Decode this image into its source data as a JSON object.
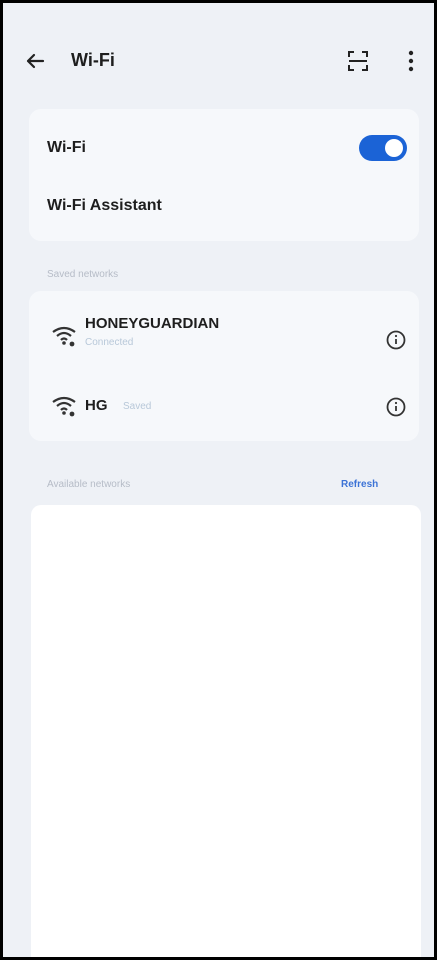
{
  "status_bar": {
    "left": "",
    "right": ""
  },
  "header": {
    "title": "Wi-Fi",
    "icons": [
      "back-arrow-icon",
      "scan-qr-icon",
      "more-options-icon"
    ]
  },
  "toggles": {
    "wifi_label": "Wi-Fi",
    "wifi_on": true,
    "assistant_label": "Wi-Fi Assistant"
  },
  "saved": {
    "section_label": "Saved networks",
    "networks": [
      {
        "name": "HONEYGUARDIAN",
        "status": "Connected"
      },
      {
        "name": "HG",
        "status": "Saved"
      }
    ]
  },
  "available": {
    "section_label": "Available networks",
    "refresh_label": "Refresh"
  },
  "colors": {
    "accent": "#1b63d6",
    "background": "#eef1f6",
    "card": "#f6f8fb"
  }
}
